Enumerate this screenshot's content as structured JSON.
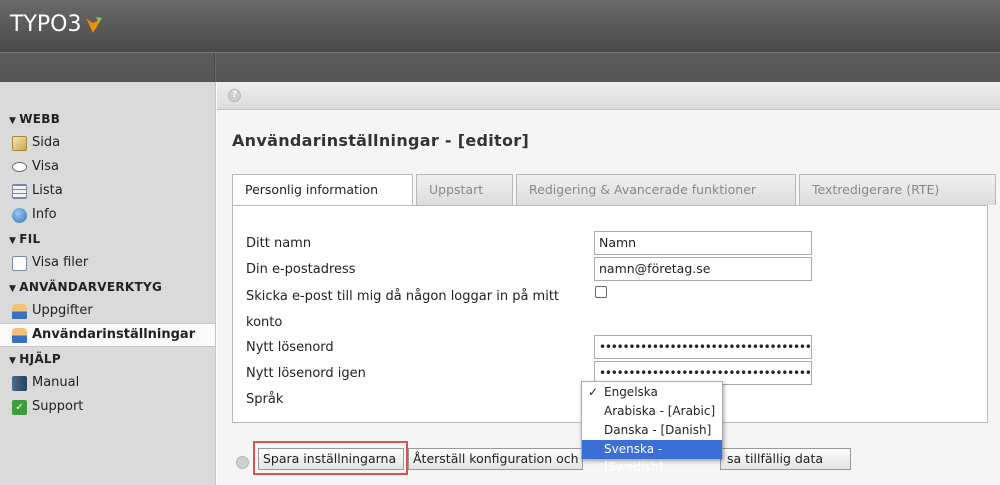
{
  "app": {
    "logo": "TYPO3"
  },
  "sidebar": {
    "sections": [
      {
        "title": "WEBB",
        "items": [
          {
            "label": "Sida",
            "icon": "page-icon"
          },
          {
            "label": "Visa",
            "icon": "eye-icon"
          },
          {
            "label": "Lista",
            "icon": "list-icon"
          },
          {
            "label": "Info",
            "icon": "info-icon"
          }
        ]
      },
      {
        "title": "FIL",
        "items": [
          {
            "label": "Visa filer",
            "icon": "folder-icon"
          }
        ]
      },
      {
        "title": "ANVÄNDARVERKTYG",
        "items": [
          {
            "label": "Uppgifter",
            "icon": "user-icon"
          },
          {
            "label": "Användarinställningar",
            "icon": "user-icon",
            "active": true
          }
        ]
      },
      {
        "title": "HJÄLP",
        "items": [
          {
            "label": "Manual",
            "icon": "book-icon"
          },
          {
            "label": "Support",
            "icon": "support-icon"
          }
        ]
      }
    ]
  },
  "main": {
    "title": "Användarinställningar - [editor]",
    "tabs": [
      {
        "label": "Personlig information",
        "active": true
      },
      {
        "label": "Uppstart"
      },
      {
        "label": "Redigering & Avancerade funktioner"
      },
      {
        "label": "Textredigerare (RTE)"
      }
    ],
    "form": {
      "name_label": "Ditt namn",
      "name_value": "Namn",
      "email_label": "Din e-postadress",
      "email_value": "namn@företag.se",
      "notify_label_line1": "Skicka e-post till mig då någon loggar in på mitt",
      "notify_label_line2": "konto",
      "notify_checked": false,
      "password_label": "Nytt lösenord",
      "password_value": "••••••••••••••••••••••••••••••••••••",
      "password_again_label": "Nytt lösenord igen",
      "password_again_value": "••••••••••••••••••••••••••••••••••••",
      "language_label": "Språk"
    },
    "language_dropdown": {
      "options": [
        "Engelska",
        "Arabiska - [Arabic]",
        "Danska - [Danish]",
        "Svenska - [Swedish]"
      ],
      "checked": "Engelska",
      "highlighted": "Svenska - [Swedish]",
      "check_mark": "✓"
    },
    "buttons": {
      "save": "Spara inställningarna",
      "reset": "Återställ konfiguration och",
      "clear": "sa tillfällig data"
    }
  },
  "colors": {
    "selection": "#3b6fd6",
    "highlight_border": "#d9534f"
  }
}
